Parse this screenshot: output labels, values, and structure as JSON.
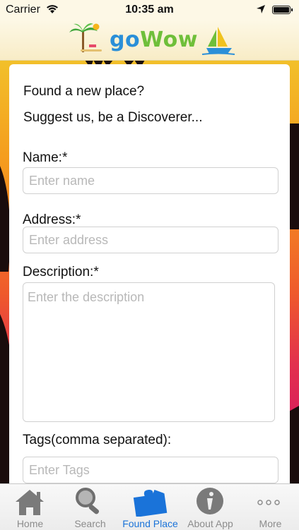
{
  "status_bar": {
    "carrier": "Carrier",
    "time": "10:35 am",
    "battery_level": 1.0
  },
  "header": {
    "logo_text_part1": "go",
    "logo_text_part2": "Wow",
    "logo_colors": {
      "go": "#2a8fd8",
      "wow": "#6fbf3a"
    }
  },
  "form": {
    "intro_line1": "Found a new place?",
    "intro_line2": "Suggest us, be a Discoverer...",
    "name_label": "Name:*",
    "name_placeholder": "Enter name",
    "address_label": "Address:*",
    "address_placeholder": "Enter address",
    "description_label": "Description:*",
    "description_placeholder": "Enter the description",
    "tags_label": "Tags(comma separated):",
    "tags_placeholder": "Enter Tags"
  },
  "tabbar": {
    "active_color": "#1a73d9",
    "tabs": [
      {
        "label": "Home",
        "icon": "home-icon"
      },
      {
        "label": "Search",
        "icon": "search-icon"
      },
      {
        "label": "Found Place",
        "icon": "puzzle-icon"
      },
      {
        "label": "About App",
        "icon": "info-icon"
      },
      {
        "label": "More",
        "icon": "more-icon"
      }
    ],
    "active_index": 2
  }
}
